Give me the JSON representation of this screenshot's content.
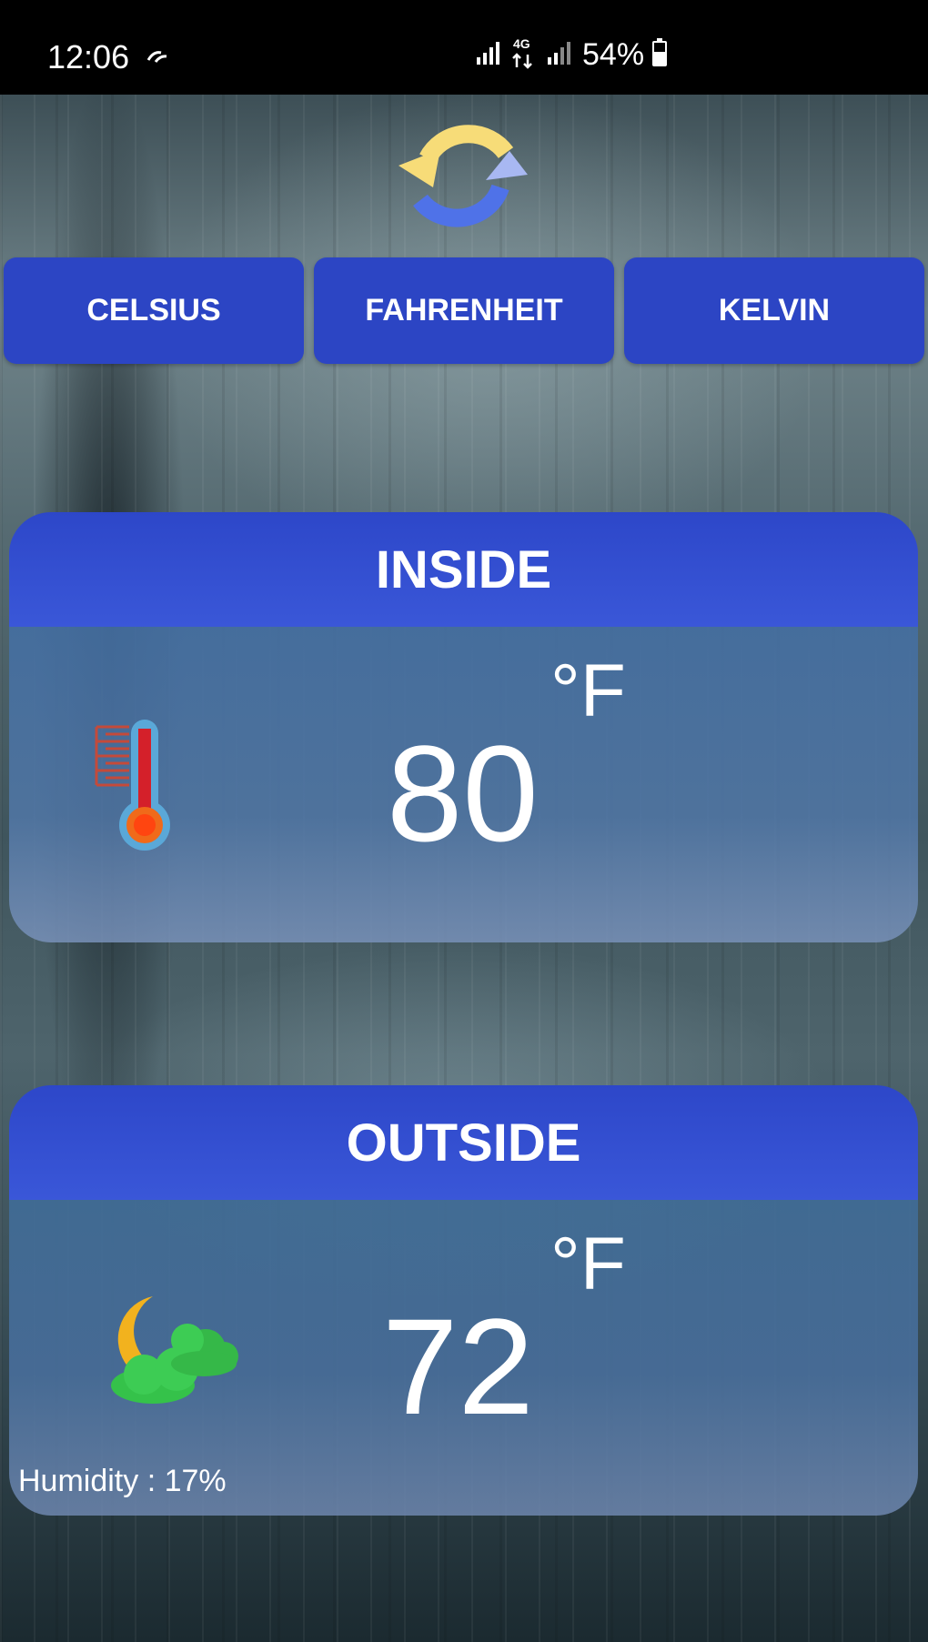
{
  "status_bar": {
    "time": "12:06",
    "network": "4G",
    "battery": "54%"
  },
  "toolbar": {
    "refresh_icon": "refresh-icon"
  },
  "units": {
    "celsius_label": "CELSIUS",
    "fahrenheit_label": "FAHRENHEIT",
    "kelvin_label": "KELVIN"
  },
  "inside": {
    "title": "INSIDE",
    "value": "80",
    "unit": "°F",
    "icon": "thermometer-icon"
  },
  "outside": {
    "title": "OUTSIDE",
    "value": "72",
    "unit": "°F",
    "icon": "moon-cloud-icon",
    "humidity": "Humidity : 17%"
  },
  "colors": {
    "accent": "#2c45c4",
    "card_header": "#3250d2",
    "text": "#ffffff"
  }
}
